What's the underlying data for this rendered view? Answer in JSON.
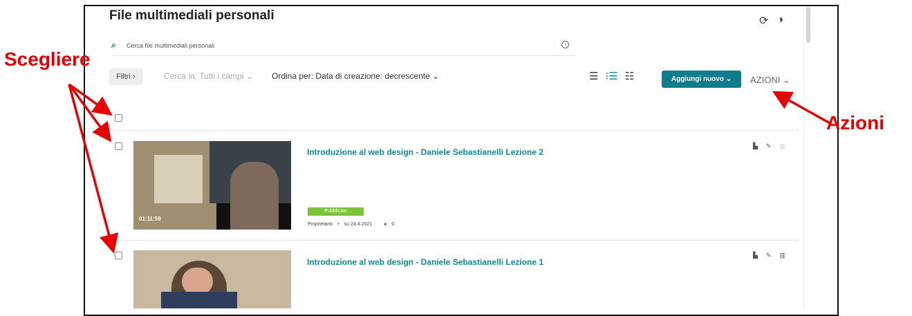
{
  "page": {
    "title": "File multimediali personali",
    "search_placeholder": "Cerca file multimediali personali",
    "filters_label": "Filtri ›",
    "search_in_label": "Cerca in: Tutti i campi  ⌄",
    "sort_label": "Ordina per: Data di creazione: decrescente  ⌄",
    "add_new_label": "Aggiungi nuovo ⌄",
    "actions_label": "AZIONI  ⌄"
  },
  "entries": [
    {
      "title": "Introduzione al web design - Daniele Sebastianelli Lezione 2",
      "duration": "01:11:59",
      "status": "Pubblicato",
      "owner": "Proprietario",
      "date": "su 24.4.2021",
      "comments": "0"
    },
    {
      "title": "Introduzione al web design - Daniele Sebastianelli Lezione 1"
    }
  ],
  "annotations": {
    "left": "Scegliere",
    "right": "Azioni"
  },
  "colors": {
    "accent": "#0f7d8c",
    "link": "#0e8a9c",
    "published": "#7cc53b",
    "annotation": "#e60000"
  },
  "icons": [
    "search-icon",
    "info-icon",
    "refresh-icon",
    "contrast-icon",
    "list-view-icon",
    "detailed-view-icon",
    "grid-view-icon",
    "chevron-down-icon",
    "analytics-icon",
    "edit-icon",
    "delete-icon",
    "comment-icon"
  ]
}
